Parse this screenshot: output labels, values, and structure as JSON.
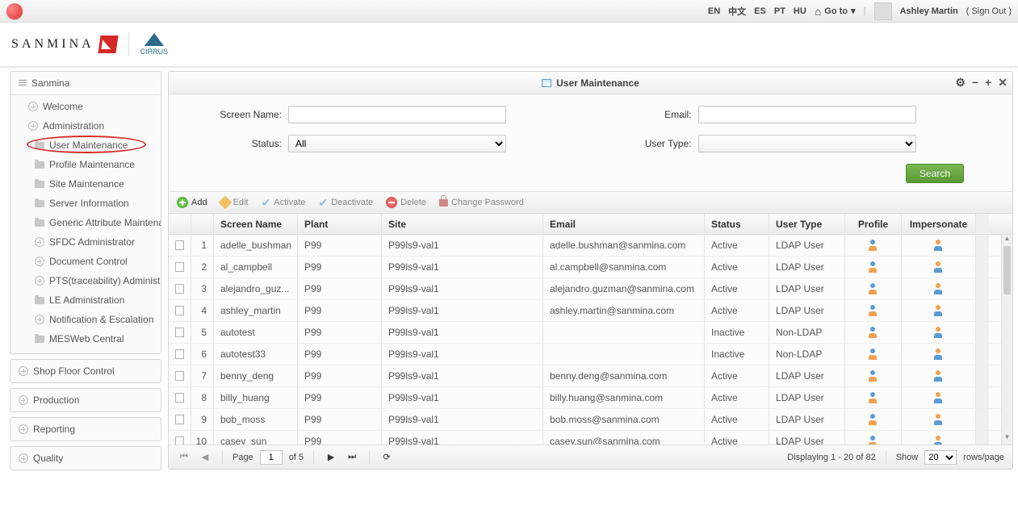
{
  "topbar": {
    "languages": [
      "EN",
      "中文",
      "ES",
      "PT",
      "HU"
    ],
    "goto_label": "Go to",
    "user_name": "Ashley Martin",
    "signout_label": "( Sign Out )"
  },
  "brand": {
    "name": "SANMINA",
    "sub": "CIRRUS"
  },
  "sidebar": {
    "root": "Sanmina",
    "sections": [
      {
        "label": "Welcome",
        "type": "plus"
      },
      {
        "label": "Administration",
        "type": "plus",
        "expanded": true,
        "children": [
          {
            "label": "User Maintenance",
            "highlighted": true
          },
          {
            "label": "Profile Maintenance"
          },
          {
            "label": "Site Maintenance"
          },
          {
            "label": "Server Information"
          },
          {
            "label": "Generic Attribute Maintena"
          },
          {
            "label": "SFDC Administrator",
            "type": "plus"
          },
          {
            "label": "Document Control",
            "type": "plus"
          },
          {
            "label": "PTS(traceability) Administra",
            "type": "plus"
          },
          {
            "label": "LE Administration"
          },
          {
            "label": "Notification & Escalation",
            "type": "plus"
          },
          {
            "label": "MESWeb Central"
          }
        ]
      },
      {
        "label": "Shop Floor Control",
        "type": "plus"
      },
      {
        "label": "Production",
        "type": "plus"
      },
      {
        "label": "Reporting",
        "type": "plus"
      },
      {
        "label": "Quality",
        "type": "plus"
      }
    ]
  },
  "panel": {
    "title": "User Maintenance",
    "filters": {
      "screen_name_label": "Screen Name:",
      "screen_name_value": "",
      "email_label": "Email:",
      "email_value": "",
      "status_label": "Status:",
      "status_value": "All",
      "user_type_label": "User Type:",
      "user_type_value": ""
    },
    "search_label": "Search",
    "toolbar": {
      "add": "Add",
      "edit": "Edit",
      "activate": "Activate",
      "deactivate": "Deactivate",
      "delete": "Delete",
      "change_pw": "Change Password"
    },
    "columns": {
      "screen_name": "Screen Name",
      "plant": "Plant",
      "site": "Site",
      "email": "Email",
      "status": "Status",
      "user_type": "User Type",
      "profile": "Profile",
      "impersonate": "Impersonate"
    },
    "rows": [
      {
        "n": "1",
        "sn": "adelle_bushman",
        "pl": "P99",
        "si": "P99ls9-val1",
        "em": "adelle.bushman@sanmina.com",
        "st": "Active",
        "ut": "LDAP User"
      },
      {
        "n": "2",
        "sn": "al_campbell",
        "pl": "P99",
        "si": "P99ls9-val1",
        "em": "al.campbell@sanmina.com",
        "st": "Active",
        "ut": "LDAP User"
      },
      {
        "n": "3",
        "sn": "alejandro_guz...",
        "pl": "P99",
        "si": "P99ls9-val1",
        "em": "alejandro.guzman@sanmina.com",
        "st": "Active",
        "ut": "LDAP User"
      },
      {
        "n": "4",
        "sn": "ashley_martin",
        "pl": "P99",
        "si": "P99ls9-val1",
        "em": "ashley.martin@sanmina.com",
        "st": "Active",
        "ut": "LDAP User"
      },
      {
        "n": "5",
        "sn": "autotest",
        "pl": "P99",
        "si": "P99ls9-val1",
        "em": "",
        "st": "Inactive",
        "ut": "Non-LDAP"
      },
      {
        "n": "6",
        "sn": "autotest33",
        "pl": "P99",
        "si": "P99ls9-val1",
        "em": "",
        "st": "Inactive",
        "ut": "Non-LDAP"
      },
      {
        "n": "7",
        "sn": "benny_deng",
        "pl": "P99",
        "si": "P99ls9-val1",
        "em": "benny.deng@sanmina.com",
        "st": "Active",
        "ut": "LDAP User"
      },
      {
        "n": "8",
        "sn": "billy_huang",
        "pl": "P99",
        "si": "P99ls9-val1",
        "em": "billy.huang@sanmina.com",
        "st": "Active",
        "ut": "LDAP User"
      },
      {
        "n": "9",
        "sn": "bob_moss",
        "pl": "P99",
        "si": "P99ls9-val1",
        "em": "bob.moss@sanmina.com",
        "st": "Active",
        "ut": "LDAP User"
      },
      {
        "n": "10",
        "sn": "casey_sun",
        "pl": "P99",
        "si": "P99ls9-val1",
        "em": "casey.sun@sanmina.com",
        "st": "Active",
        "ut": "LDAP User"
      }
    ],
    "pager": {
      "page_label": "Page",
      "page_value": "1",
      "of_label": "of 5",
      "display": "Displaying 1 - 20 of 82",
      "show_label": "Show",
      "show_value": "20",
      "rows_label": "rows/page"
    }
  }
}
